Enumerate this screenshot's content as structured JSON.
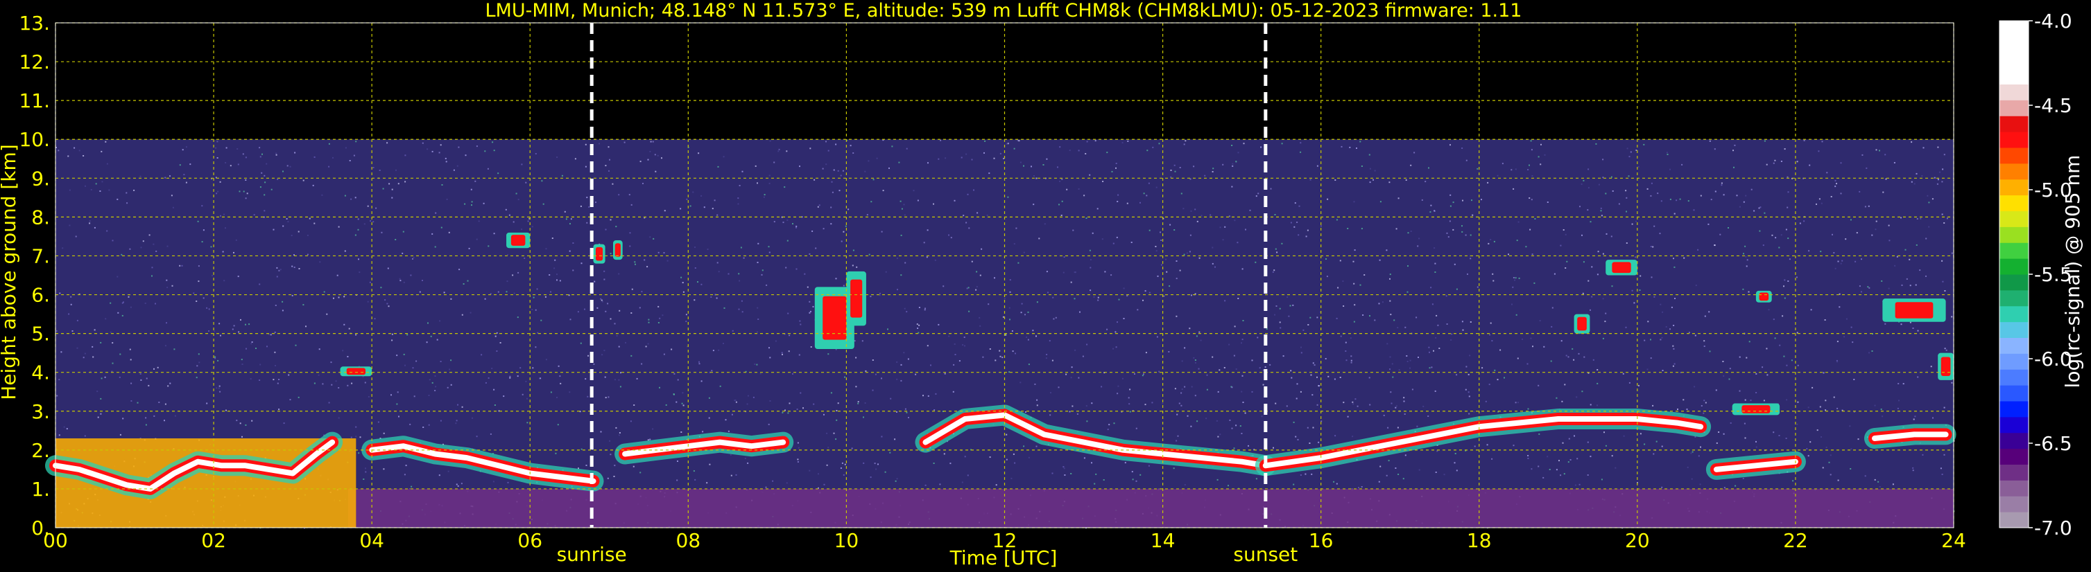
{
  "chart_data": {
    "type": "heatmap",
    "title": "LMU-MIM, Munich; 48.148° N 11.573° E, altitude: 539 m    Lufft CHM8k (CHM8kLMU): 05-12-2023    firmware: 1.11",
    "xlabel": "Time [UTC]",
    "ylabel": "Height above ground [km]",
    "xlim": [
      0,
      24
    ],
    "ylim": [
      0,
      13
    ],
    "x_ticks": [
      "00",
      "02",
      "04",
      "06",
      "08",
      "10",
      "12",
      "14",
      "16",
      "18",
      "20",
      "22",
      "24"
    ],
    "y_ticks": [
      "0.",
      "1.",
      "2.",
      "3.",
      "4.",
      "5.",
      "6.",
      "7.",
      "8.",
      "9.",
      "10.",
      "11.",
      "12.",
      "13."
    ],
    "grid": true,
    "data_top_km": 10,
    "events": [
      {
        "label": "sunrise",
        "time": 6.78
      },
      {
        "label": "sunset",
        "time": 15.3
      }
    ],
    "colorbar": {
      "label": "log(rc-signal) @ 905 nm",
      "range": [
        -7.0,
        -4.0
      ],
      "ticks": [
        "-4.0",
        "-4.5",
        "-5.0",
        "-5.5",
        "-6.0",
        "-6.5",
        "-7.0"
      ],
      "colors": [
        "#a89ab0",
        "#9a7ea6",
        "#8a5e98",
        "#6f2f86",
        "#57007a",
        "#3a0096",
        "#1a00d6",
        "#0020ff",
        "#2a58ff",
        "#4c7cff",
        "#6f9cff",
        "#8ab4ff",
        "#58c7e6",
        "#2fcfb0",
        "#1fb070",
        "#109848",
        "#14b030",
        "#40d040",
        "#9ae020",
        "#d8e818",
        "#ffe000",
        "#ffb000",
        "#ff8000",
        "#ff4800",
        "#ff1010",
        "#e81010",
        "#e8a8a8",
        "#f0d8d8",
        "#ffffff",
        "#ffffff",
        "#ffffff",
        "#ffffff"
      ]
    },
    "layers": [
      {
        "name": "aerosol-surface",
        "x": [
          3.7,
          24
        ],
        "y": [
          0,
          1.0
        ],
        "value": -6.7
      },
      {
        "name": "boundary-layer-night",
        "x": [
          0,
          3.8
        ],
        "y": [
          0,
          2.3
        ],
        "value": -5.0
      }
    ],
    "cloud_tracks": [
      {
        "x": [
          0.0,
          0.3,
          0.6,
          0.9,
          1.2,
          1.5,
          1.8,
          2.1,
          2.4,
          2.7,
          3.0,
          3.3,
          3.5
        ],
        "y": [
          1.6,
          1.5,
          1.3,
          1.1,
          1.0,
          1.4,
          1.7,
          1.6,
          1.6,
          1.5,
          1.4,
          1.9,
          2.2
        ]
      },
      {
        "x": [
          4.0,
          4.4,
          4.8,
          5.2,
          5.6,
          6.0,
          6.4,
          6.8
        ],
        "y": [
          2.0,
          2.1,
          1.9,
          1.8,
          1.6,
          1.4,
          1.3,
          1.2
        ]
      },
      {
        "x": [
          7.2,
          7.6,
          8.0,
          8.4,
          8.8,
          9.2
        ],
        "y": [
          1.9,
          2.0,
          2.1,
          2.2,
          2.1,
          2.2
        ]
      },
      {
        "x": [
          11.0,
          11.5,
          12.0,
          12.5,
          13.0,
          13.5,
          14.0,
          14.5,
          15.0,
          15.3
        ],
        "y": [
          2.2,
          2.8,
          2.9,
          2.4,
          2.2,
          2.0,
          1.9,
          1.8,
          1.7,
          1.6
        ]
      },
      {
        "x": [
          15.3,
          16.0,
          16.5,
          17.0,
          17.5,
          18.0,
          18.5,
          19.0,
          19.5,
          20.0,
          20.5,
          20.8
        ],
        "y": [
          1.6,
          1.8,
          2.0,
          2.2,
          2.4,
          2.6,
          2.7,
          2.8,
          2.8,
          2.8,
          2.7,
          2.6
        ]
      },
      {
        "x": [
          21.0,
          21.5,
          22.0
        ],
        "y": [
          1.5,
          1.6,
          1.7
        ]
      },
      {
        "x": [
          23.0,
          23.5,
          23.9
        ],
        "y": [
          2.3,
          2.4,
          2.4
        ]
      }
    ],
    "cloud_patches": [
      {
        "x": 9.6,
        "y": 4.6,
        "w": 0.5,
        "h": 1.6
      },
      {
        "x": 10.0,
        "y": 5.2,
        "w": 0.25,
        "h": 1.4
      },
      {
        "x": 6.8,
        "y": 6.8,
        "w": 0.15,
        "h": 0.5
      },
      {
        "x": 7.05,
        "y": 6.9,
        "w": 0.12,
        "h": 0.5
      },
      {
        "x": 5.7,
        "y": 7.2,
        "w": 0.3,
        "h": 0.4
      },
      {
        "x": 3.6,
        "y": 3.9,
        "w": 0.4,
        "h": 0.25
      },
      {
        "x": 19.6,
        "y": 6.5,
        "w": 0.4,
        "h": 0.4
      },
      {
        "x": 21.5,
        "y": 5.8,
        "w": 0.2,
        "h": 0.3
      },
      {
        "x": 23.1,
        "y": 5.3,
        "w": 0.8,
        "h": 0.6
      },
      {
        "x": 23.8,
        "y": 3.8,
        "w": 0.2,
        "h": 0.7
      },
      {
        "x": 19.2,
        "y": 5.0,
        "w": 0.2,
        "h": 0.5
      },
      {
        "x": 21.2,
        "y": 2.9,
        "w": 0.6,
        "h": 0.3
      }
    ]
  }
}
